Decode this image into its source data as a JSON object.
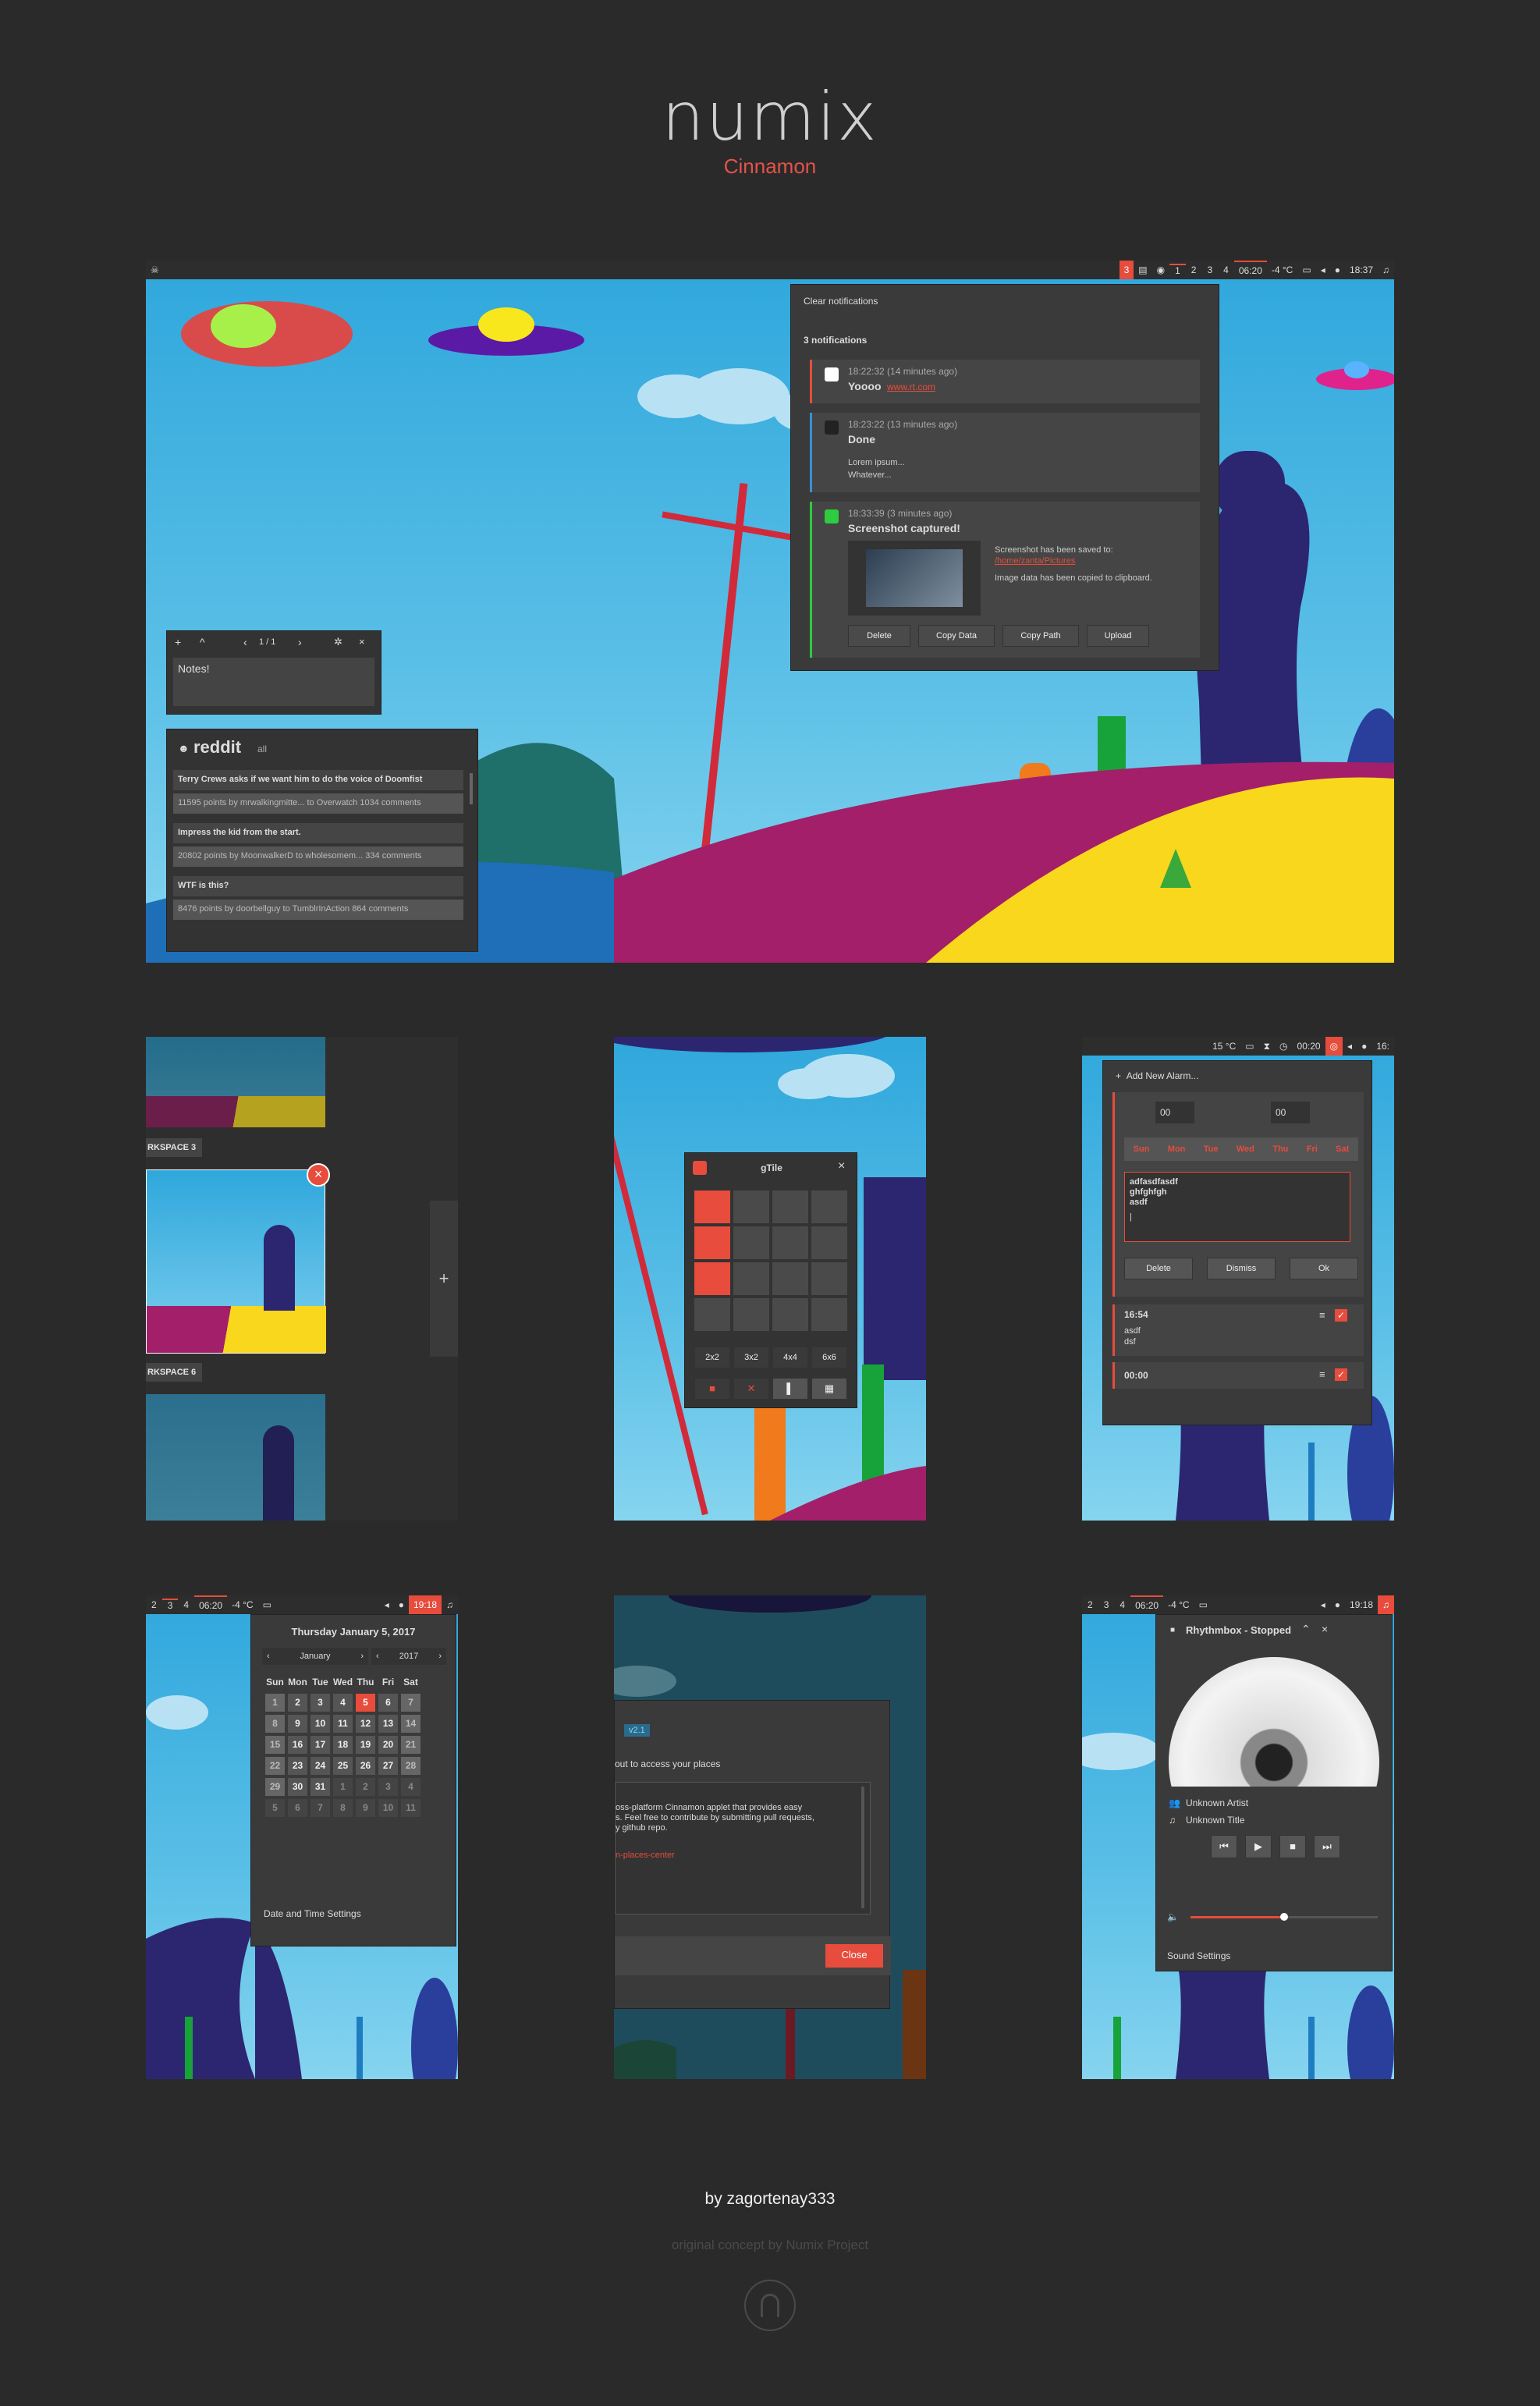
{
  "brand": {
    "logo": "numix",
    "subtitle": "Cinnamon",
    "author": "by zagortenay333",
    "concept": "original concept by Numix Project"
  },
  "colors": {
    "accent": "#e74c3c",
    "bg": "#2a2a2a",
    "panel": "#2d2d2d",
    "popup": "#3a3a3a"
  },
  "main_shot": {
    "panel": {
      "notif_count": "3",
      "workspaces": [
        "1",
        "2",
        "3",
        "4"
      ],
      "timer": "06:20",
      "weather": "-4 °C",
      "time": "18:37"
    },
    "notifications": {
      "clear": "Clear notifications",
      "count": "3 notifications",
      "items": [
        {
          "time": "18:22:32 (14 minutes ago)",
          "title": "Yoooo",
          "link": "www.rt.com"
        },
        {
          "time": "18:23:22 (13 minutes ago)",
          "title": "Done",
          "body1": "Lorem ipsum...",
          "body2": "Whatever..."
        },
        {
          "time": "18:33:39 (3 minutes ago)",
          "title": "Screenshot captured!",
          "saved": "Screenshot has been saved to:",
          "path": "/home/zanta/Pictures",
          "copied": "Image data has been copied to clipboard.",
          "buttons": [
            "Delete",
            "Copy Data",
            "Copy Path",
            "Upload"
          ]
        }
      ]
    },
    "notes": {
      "page": "1 / 1",
      "text": "Notes!"
    },
    "reddit": {
      "title": "reddit",
      "sub": "all",
      "posts": [
        {
          "title": "Terry Crews asks if we want him to do the voice of Doomfist",
          "meta": "11595 points by mrwalkingmitte... to Overwatch 1034 comments"
        },
        {
          "title": "Impress the kid from the start.",
          "meta": "20802 points by MoonwalkerD to wholesomem... 334 comments"
        },
        {
          "title": "WTF is this?",
          "meta": "8476 points by doorbellguy to TumblrInAction 864 comments"
        }
      ]
    }
  },
  "workspaces_shot": {
    "labels": [
      "RKSPACE 3",
      "RKSPACE 6"
    ],
    "add": "+",
    "close": "×"
  },
  "gtile_shot": {
    "title": "gTile",
    "close": "×",
    "presets": [
      "2x2",
      "3x2",
      "4x4",
      "6x6"
    ]
  },
  "alarm_shot": {
    "panel": {
      "weather": "15 °C",
      "timer": "00:20",
      "time": "16:"
    },
    "add": "Add New Alarm...",
    "hour": "00",
    "minute": "00",
    "days": [
      "Sun",
      "Mon",
      "Tue",
      "Wed",
      "Thu",
      "Fri",
      "Sat"
    ],
    "note_lines": [
      "adfasdfasdf",
      "ghfghfgh",
      "asdf",
      "|"
    ],
    "buttons": [
      "Delete",
      "Dismiss",
      "Ok"
    ],
    "alarms": [
      {
        "time": "16:54",
        "l1": "asdf",
        "l2": "dsf"
      },
      {
        "time": "00:00"
      }
    ]
  },
  "calendar_shot": {
    "panel": {
      "workspaces": [
        "2",
        "3",
        "4"
      ],
      "timer": "06:20",
      "weather": "-4 °C",
      "time": "19:18"
    },
    "date": "Thursday January 5, 2017",
    "month": "January",
    "year": "2017",
    "weekdays": [
      "Sun",
      "Mon",
      "Tue",
      "Wed",
      "Thu",
      "Fri",
      "Sat"
    ],
    "weeks": [
      [
        "1",
        "2",
        "3",
        "4",
        "5",
        "6",
        "7"
      ],
      [
        "8",
        "9",
        "10",
        "11",
        "12",
        "13",
        "14"
      ],
      [
        "15",
        "16",
        "17",
        "18",
        "19",
        "20",
        "21"
      ],
      [
        "22",
        "23",
        "24",
        "25",
        "26",
        "27",
        "28"
      ],
      [
        "29",
        "30",
        "31",
        "1",
        "2",
        "3",
        "4"
      ],
      [
        "5",
        "6",
        "7",
        "8",
        "9",
        "10",
        "11"
      ]
    ],
    "settings": "Date and Time Settings"
  },
  "about_shot": {
    "version": "v2.1",
    "l1": "out to access your places",
    "l2": "oss-platform Cinnamon applet that provides easy",
    "l3": "s. Feel free to contribute by submitting pull requests,",
    "l4": "y github repo.",
    "link": "n-places-center",
    "close": "Close"
  },
  "music_shot": {
    "panel": {
      "workspaces": [
        "2",
        "3",
        "4"
      ],
      "timer": "06:20",
      "weather": "-4 °C",
      "time": "19:18"
    },
    "title": "Rhythmbox - Stopped",
    "artist": "Unknown Artist",
    "track": "Unknown Title",
    "volume": 0.5,
    "settings": "Sound Settings"
  }
}
